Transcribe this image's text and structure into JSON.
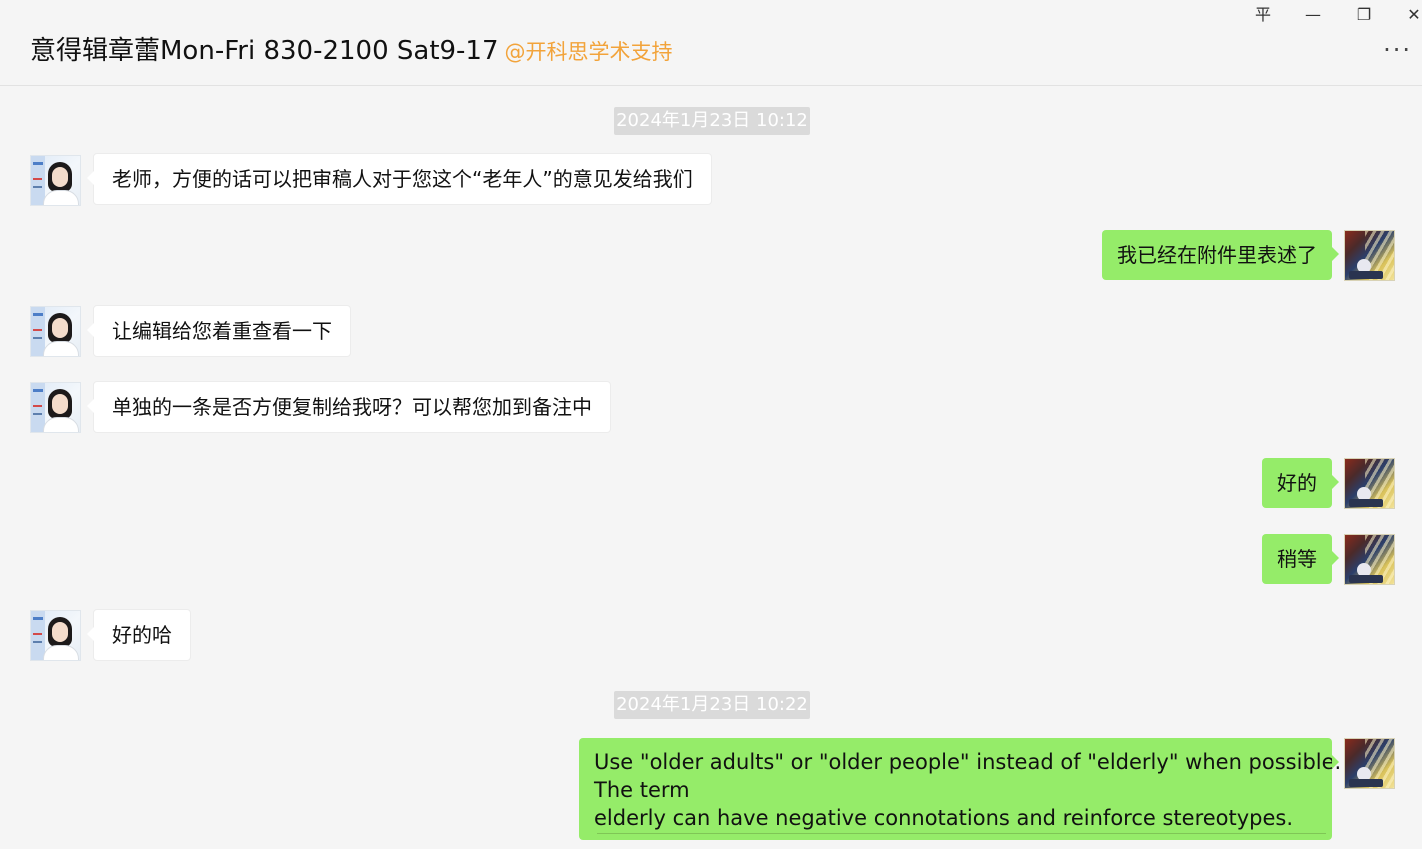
{
  "header": {
    "title": "意得辑章蕾Mon-Fri 830-2100 Sat9-17",
    "org": "@开科思学术支持",
    "controls": {
      "pin": "平",
      "minimize": "—",
      "restore": "❐",
      "close": "✕",
      "more": "···"
    }
  },
  "timestamps": [
    "2024年1月23日 10:12",
    "2024年1月23日 10:22"
  ],
  "messages": [
    {
      "side": "left",
      "text": "老师，方便的话可以把审稿人对于您这个“老年人”的意见发给我们"
    },
    {
      "side": "right",
      "text": "我已经在附件里表述了"
    },
    {
      "side": "left",
      "text": "让编辑给您着重查看一下"
    },
    {
      "side": "left",
      "text": "单独的一条是否方便复制给我呀？可以帮您加到备注中"
    },
    {
      "side": "right",
      "text": "好的"
    },
    {
      "side": "right",
      "text": "稍等"
    },
    {
      "side": "left",
      "text": "好的哈"
    },
    {
      "side": "right",
      "lines": [
        "Use \"older adults\" or \"older people\" instead of \"elderly\" when possible.",
        "The term",
        "elderly can have negative connotations and reinforce stereotypes."
      ]
    }
  ],
  "colors": {
    "bubble_self": "#95ec69",
    "bubble_other": "#ffffff",
    "org_accent": "#f2a33a",
    "timestamp_bg": "#dadada"
  }
}
